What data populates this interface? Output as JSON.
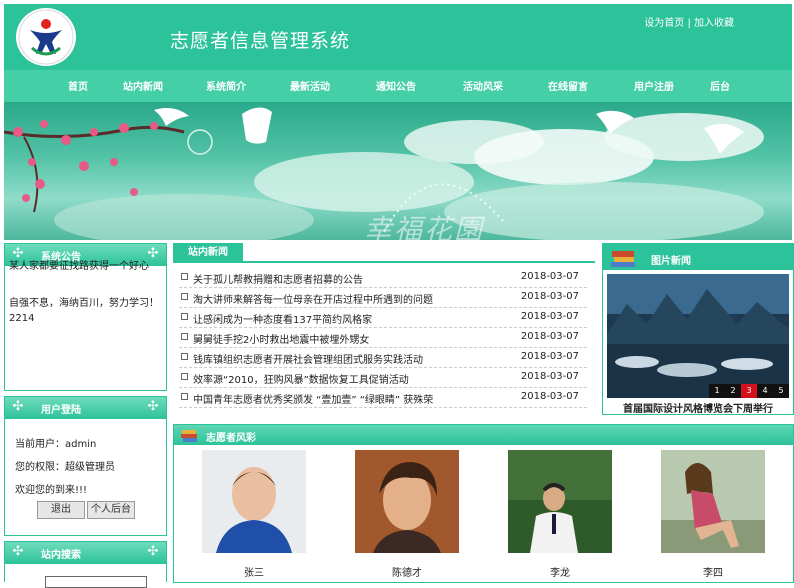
{
  "header": {
    "title": "志愿者信息管理系统",
    "top_links": [
      "设为首页",
      "加入收藏"
    ],
    "link_separator": "|"
  },
  "nav": [
    "首页",
    "站内新闻",
    "系统简介",
    "最新活动",
    "通知公告",
    "活动风采",
    "在线留言",
    "用户注册",
    "后台"
  ],
  "banner": {
    "watermark": "幸福花園"
  },
  "notice": {
    "title": "系统公告",
    "text1": "某人家都要征找路获得一个好心情，谢谢！",
    "text2": "自强不息，海纳百川，努力学习！2214"
  },
  "login": {
    "title": "用户登陆",
    "user_label": "当前用户：admin",
    "role_label": "您的权限：超级管理员",
    "welcome": "欢迎您的到来!!!",
    "logout_button": "退出",
    "backend_button": "个人后台"
  },
  "search": {
    "title": "站内搜索"
  },
  "news": {
    "tab": "站内新闻",
    "items": [
      {
        "title": "关于孤儿帮教捐赠和志愿者招募的公告",
        "date": "2018-03-07"
      },
      {
        "title": "淘大讲师来解答每一位母亲在开店过程中所遇到的问题",
        "date": "2018-03-07"
      },
      {
        "title": "让感闲成为一种态度看137平简约风格家",
        "date": "2018-03-07"
      },
      {
        "title": "舅舅徒手挖2小时救出地震中被埋外甥女",
        "date": "2018-03-07"
      },
      {
        "title": "钱库镇组织志愿者开展社会管理组团式服务实践活动",
        "date": "2018-03-07"
      },
      {
        "title": "效率源“2010，狂购风暴”数据恢复工具促销活动",
        "date": "2018-03-07"
      },
      {
        "title": "中国青年志愿者优秀奖颁发 “壹加壹” “绿眼睛” 获殊荣",
        "date": "2018-03-07"
      }
    ]
  },
  "pic_news": {
    "title": "图片新闻",
    "pages": [
      "1",
      "2",
      "3",
      "4",
      "5"
    ],
    "active_page": "3",
    "caption": "首届国际设计风格博览会下周举行"
  },
  "volunteers": {
    "title": "志愿者风彩",
    "people": [
      {
        "name": "张三"
      },
      {
        "name": "陈德才"
      },
      {
        "name": "李龙"
      },
      {
        "name": "李四"
      }
    ]
  },
  "colors": {
    "brand": "#2cc29a",
    "nav": "#45cfa7",
    "active_page": "#d4101a"
  }
}
